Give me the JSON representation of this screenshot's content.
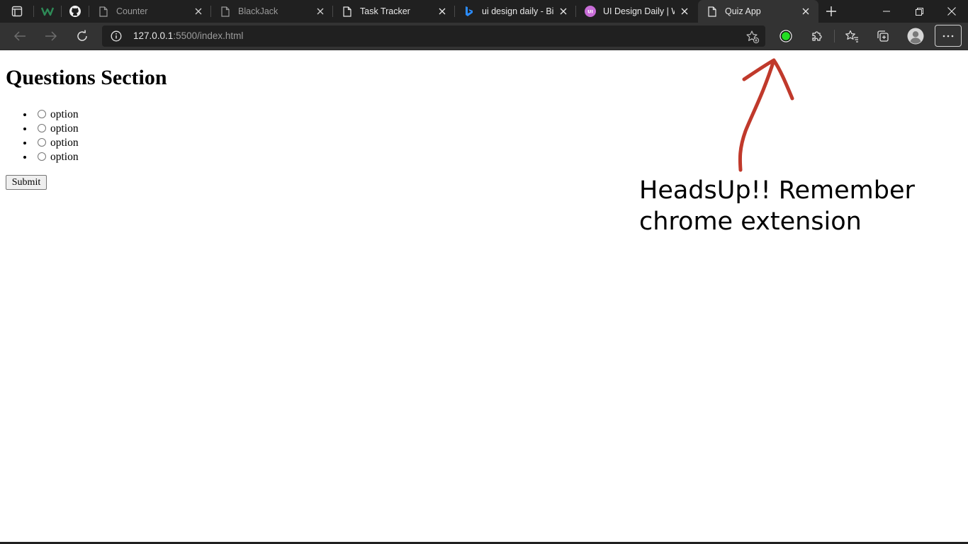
{
  "browser": {
    "tabs": [
      {
        "title": "Counter",
        "icon": "page-icon",
        "dim": true
      },
      {
        "title": "BlackJack",
        "icon": "page-icon",
        "dim": true
      },
      {
        "title": "Task Tracker",
        "icon": "page-icon",
        "dim": false
      },
      {
        "title": "ui design daily - Bing",
        "icon": "bing-icon",
        "dim": false
      },
      {
        "title": "UI Design Daily | Website",
        "icon": "ui-design-daily-icon",
        "dim": false
      },
      {
        "title": "Quiz App",
        "icon": "page-icon",
        "dim": false,
        "active": true
      }
    ],
    "url_host": "127.0.0.1",
    "url_rest": ":5500/index.html"
  },
  "page": {
    "heading": "Questions Section",
    "options": [
      "option",
      "option",
      "option",
      "option"
    ],
    "submit_label": "Submit"
  },
  "annotation": {
    "line1": "HeadsUp!! Remember",
    "line2": "chrome extension",
    "arrow_color": "#c0392b"
  },
  "colors": {
    "tabstrip": "#202020",
    "toolbar": "#333333",
    "extension_green": "#22dd22"
  }
}
